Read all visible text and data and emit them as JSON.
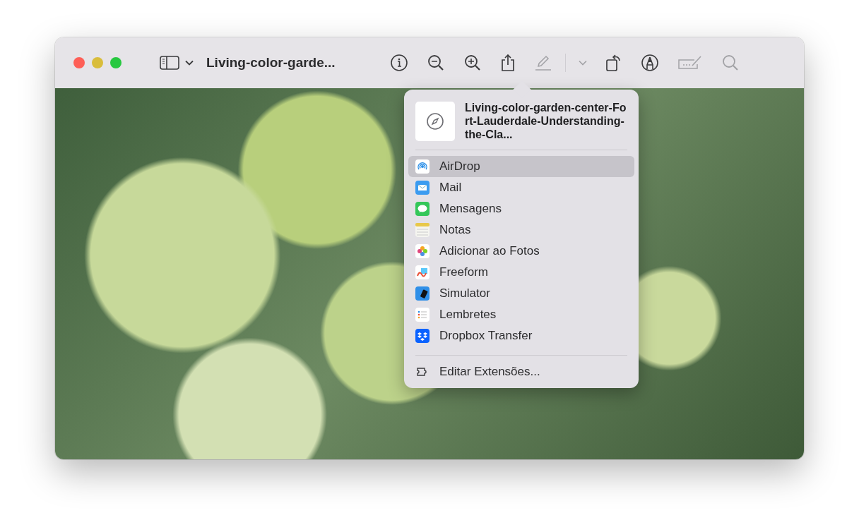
{
  "window": {
    "title": "Living-color-garde..."
  },
  "toolbar": [
    {
      "kind": "info",
      "disabled": false
    },
    {
      "kind": "zoom-out",
      "disabled": false
    },
    {
      "kind": "zoom-in",
      "disabled": false
    },
    {
      "kind": "share",
      "disabled": false
    },
    {
      "kind": "markup",
      "disabled": true
    },
    {
      "kind": "rotate",
      "disabled": false
    },
    {
      "kind": "pen",
      "disabled": false
    },
    {
      "kind": "form",
      "disabled": true
    },
    {
      "kind": "search",
      "disabled": true
    }
  ],
  "share_menu": {
    "file_name": "Living-color-garden-center-Fort-Lauderdale-Understanding-the-Cla...",
    "items": [
      {
        "label": "AirDrop",
        "kind": "airdrop",
        "selected": true
      },
      {
        "label": "Mail",
        "kind": "mail",
        "selected": false
      },
      {
        "label": "Mensagens",
        "kind": "messages",
        "selected": false
      },
      {
        "label": "Notas",
        "kind": "notes",
        "selected": false
      },
      {
        "label": "Adicionar ao Fotos",
        "kind": "photos",
        "selected": false
      },
      {
        "label": "Freeform",
        "kind": "freeform",
        "selected": false
      },
      {
        "label": "Simulator",
        "kind": "simulator",
        "selected": false
      },
      {
        "label": "Lembretes",
        "kind": "reminders",
        "selected": false
      },
      {
        "label": "Dropbox Transfer",
        "kind": "dropbox",
        "selected": false
      }
    ],
    "footer": "Editar Extensões..."
  }
}
